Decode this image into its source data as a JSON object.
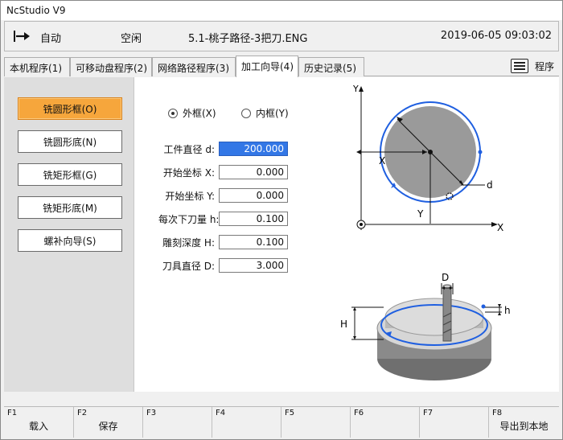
{
  "window": {
    "title": "NcStudio V9"
  },
  "status": {
    "mode": "自动",
    "state": "空闲",
    "file": "5.1-桃子路径-3把刀.ENG",
    "datetime": "2019-06-05 09:03:02"
  },
  "tabs": [
    {
      "label": "本机程序(1)",
      "active": false
    },
    {
      "label": "可移动盘程序(2)",
      "active": false
    },
    {
      "label": "网络路径程序(3)",
      "active": false
    },
    {
      "label": "加工向导(4)",
      "active": true
    },
    {
      "label": "历史记录(5)",
      "active": false
    }
  ],
  "program_button": {
    "label": "程序",
    "icon": "list-icon"
  },
  "wizard_menu": [
    {
      "label": "铣圆形框(O)",
      "active": true
    },
    {
      "label": "铣圆形底(N)",
      "active": false
    },
    {
      "label": "铣矩形框(G)",
      "active": false
    },
    {
      "label": "铣矩形底(M)",
      "active": false
    },
    {
      "label": "螺补向导(S)",
      "active": false
    }
  ],
  "frame_options": [
    {
      "label": "外框(X)",
      "selected": true
    },
    {
      "label": "内框(Y)",
      "selected": false
    }
  ],
  "fields": [
    {
      "label": "工件直径 d:",
      "value": "200.000",
      "selected": true
    },
    {
      "label": "开始坐标 X:",
      "value": "0.000",
      "selected": false
    },
    {
      "label": "开始坐标 Y:",
      "value": "0.000",
      "selected": false
    },
    {
      "label": "每次下刀量 h:",
      "value": "0.100",
      "selected": false
    },
    {
      "label": "雕刻深度 H:",
      "value": "0.100",
      "selected": false
    },
    {
      "label": "刀具直径 D:",
      "value": "3.000",
      "selected": false
    }
  ],
  "diagram_top": {
    "axis_y": "Y",
    "axis_x": "X",
    "dim_x": "X",
    "dim_y": "Y",
    "dim_d": "d"
  },
  "diagram_bottom": {
    "dim_D": "D",
    "dim_h": "h",
    "dim_H": "H"
  },
  "function_keys": [
    {
      "key": "F1",
      "label": "载入"
    },
    {
      "key": "F2",
      "label": "保存"
    },
    {
      "key": "F3",
      "label": ""
    },
    {
      "key": "F4",
      "label": ""
    },
    {
      "key": "F5",
      "label": ""
    },
    {
      "key": "F6",
      "label": ""
    },
    {
      "key": "F7",
      "label": ""
    },
    {
      "key": "F8",
      "label": "导出到本地"
    }
  ],
  "colors": {
    "accent": "#f6a63c",
    "selection": "#3377e6",
    "toolpath": "#1f5fe0"
  }
}
